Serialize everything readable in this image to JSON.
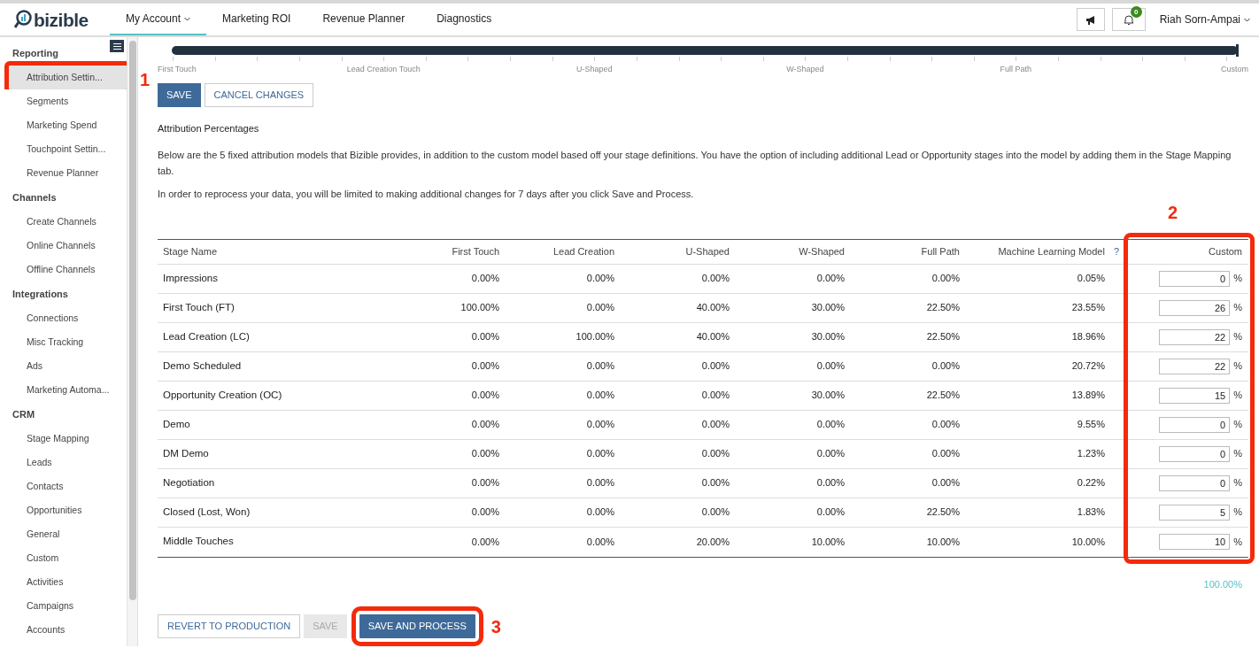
{
  "nav": {
    "logo": "bizible",
    "tabs": [
      {
        "label": "My Account",
        "selected": true,
        "dropdown": true
      },
      {
        "label": "Marketing ROI",
        "selected": false,
        "dropdown": false
      },
      {
        "label": "Revenue Planner",
        "selected": false,
        "dropdown": false
      },
      {
        "label": "Diagnostics",
        "selected": false,
        "dropdown": false
      }
    ],
    "notification_count": "0",
    "user": "Riah Sorn-Ampai"
  },
  "sidebar": {
    "sections": [
      {
        "heading": "Reporting",
        "items": [
          {
            "label": "Attribution Settin...",
            "selected": true,
            "callout": "1"
          },
          {
            "label": "Segments",
            "selected": false
          },
          {
            "label": "Marketing Spend",
            "selected": false
          },
          {
            "label": "Touchpoint Settin...",
            "selected": false
          },
          {
            "label": "Revenue Planner",
            "selected": false
          }
        ]
      },
      {
        "heading": "Channels",
        "items": [
          {
            "label": "Create Channels",
            "selected": false
          },
          {
            "label": "Online Channels",
            "selected": false
          },
          {
            "label": "Offline Channels",
            "selected": false
          }
        ]
      },
      {
        "heading": "Integrations",
        "items": [
          {
            "label": "Connections",
            "selected": false
          },
          {
            "label": "Misc Tracking",
            "selected": false
          },
          {
            "label": "Ads",
            "selected": false
          },
          {
            "label": "Marketing Automa...",
            "selected": false
          }
        ]
      },
      {
        "heading": "CRM",
        "items": [
          {
            "label": "Stage Mapping",
            "selected": false
          },
          {
            "label": "Leads",
            "selected": false
          },
          {
            "label": "Contacts",
            "selected": false
          },
          {
            "label": "Opportunities",
            "selected": false
          },
          {
            "label": "General",
            "selected": false
          },
          {
            "label": "Custom",
            "selected": false
          },
          {
            "label": "Activities",
            "selected": false
          },
          {
            "label": "Campaigns",
            "selected": false
          },
          {
            "label": "Accounts",
            "selected": false
          }
        ]
      }
    ]
  },
  "model_slider": {
    "level": 1,
    "labels": [
      "First Touch",
      "Lead Creation Touch",
      "U-Shaped",
      "W-Shaped",
      "Full Path",
      "Custom"
    ]
  },
  "top_buttons": [
    {
      "label": "SAVE",
      "kind": "primary"
    },
    {
      "label": "CANCEL CHANGES",
      "kind": "outline"
    }
  ],
  "section_title": "Attribution Percentages",
  "paragraphs": [
    "Below are the 5 fixed attribution models that Bizible provides, in addition to the custom model based off your stage definitions. You have the option of including additional Lead or Opportunity stages into the model by adding them in the Stage Mapping tab.",
    "In order to reprocess your data, you will be limited to making additional changes for 7 days after you click Save and Process."
  ],
  "table": {
    "columns": [
      "Stage Name",
      "First Touch",
      "Lead Creation",
      "U-Shaped",
      "W-Shaped",
      "Full Path",
      "Machine Learning Model",
      "Custom"
    ],
    "help_mark": "?",
    "custom_callout": "2",
    "unit": "%",
    "rows": [
      {
        "cells": [
          "Impressions",
          "0.00%",
          "0.00%",
          "0.00%",
          "0.00%",
          "0.00%",
          "0.05%"
        ],
        "custom": "0"
      },
      {
        "cells": [
          "First Touch (FT)",
          "100.00%",
          "0.00%",
          "40.00%",
          "30.00%",
          "22.50%",
          "23.55%"
        ],
        "custom": "26"
      },
      {
        "cells": [
          "Lead Creation (LC)",
          "0.00%",
          "100.00%",
          "40.00%",
          "30.00%",
          "22.50%",
          "18.96%"
        ],
        "custom": "22"
      },
      {
        "cells": [
          "Demo Scheduled",
          "0.00%",
          "0.00%",
          "0.00%",
          "0.00%",
          "0.00%",
          "20.72%"
        ],
        "custom": "22"
      },
      {
        "cells": [
          "Opportunity Creation (OC)",
          "0.00%",
          "0.00%",
          "0.00%",
          "30.00%",
          "22.50%",
          "13.89%"
        ],
        "custom": "15"
      },
      {
        "cells": [
          "Demo",
          "0.00%",
          "0.00%",
          "0.00%",
          "0.00%",
          "0.00%",
          "9.55%"
        ],
        "custom": "0"
      },
      {
        "cells": [
          "DM Demo",
          "0.00%",
          "0.00%",
          "0.00%",
          "0.00%",
          "0.00%",
          "1.23%"
        ],
        "custom": "0"
      },
      {
        "cells": [
          "Negotiation",
          "0.00%",
          "0.00%",
          "0.00%",
          "0.00%",
          "0.00%",
          "0.22%"
        ],
        "custom": "0"
      },
      {
        "cells": [
          "Closed (Lost, Won)",
          "0.00%",
          "0.00%",
          "0.00%",
          "0.00%",
          "22.50%",
          "1.83%"
        ],
        "custom": "5"
      },
      {
        "cells": [
          "Middle Touches",
          "0.00%",
          "0.00%",
          "20.00%",
          "10.00%",
          "10.00%",
          "10.00%"
        ],
        "custom": "10"
      }
    ],
    "total": "100.00%"
  },
  "bottom_buttons": [
    {
      "label": "REVERT TO PRODUCTION",
      "kind": "outline",
      "disabled": false
    },
    {
      "label": "SAVE",
      "kind": "primary",
      "disabled": true
    },
    {
      "label": "SAVE AND PROCESS",
      "kind": "primary",
      "disabled": false,
      "callout": "3"
    }
  ]
}
